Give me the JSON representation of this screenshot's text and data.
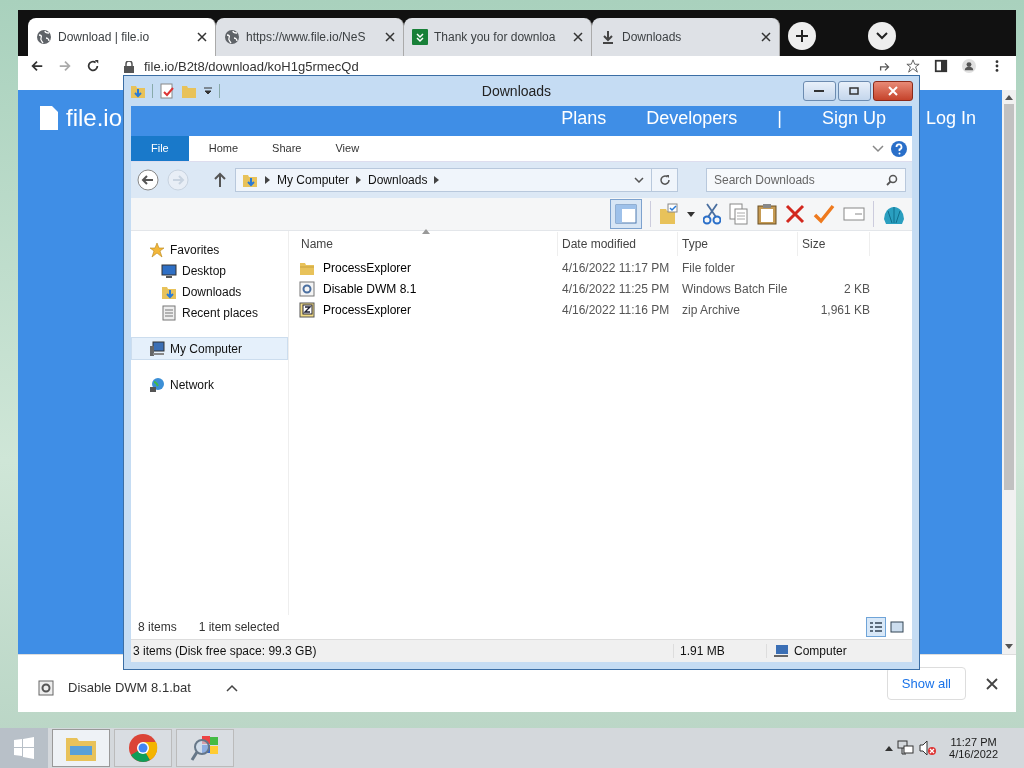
{
  "browser": {
    "tabs": [
      {
        "title": "Download | file.io",
        "kind": "globe",
        "selected": true
      },
      {
        "title": "https://www.file.io/NeS",
        "kind": "globe",
        "selected": false
      },
      {
        "title": "Thank you for downloa",
        "kind": "sheet",
        "selected": false
      },
      {
        "title": "Downloads",
        "kind": "download",
        "selected": false
      }
    ],
    "address": "file.io/B2t8/download/koH1g5rmecQd"
  },
  "site": {
    "logo": "file.io",
    "nav": [
      "Plans",
      "Developers",
      "|",
      "Sign Up",
      "Log In"
    ]
  },
  "explorer": {
    "title": "Downloads",
    "ribbon_tabs": [
      {
        "label": "File",
        "selected": true
      },
      {
        "label": "Home",
        "selected": false
      },
      {
        "label": "Share",
        "selected": false
      },
      {
        "label": "View",
        "selected": false
      }
    ],
    "breadcrumb": [
      "My Computer",
      "Downloads"
    ],
    "search": {
      "placeholder": "Search Downloads"
    },
    "nav_pane": [
      {
        "label": "Favorites",
        "kind": "star",
        "selected": false,
        "children": [
          {
            "label": "Desktop",
            "kind": "desktop",
            "selected": false
          },
          {
            "label": "Downloads",
            "kind": "downloads",
            "selected": false
          },
          {
            "label": "Recent places",
            "kind": "recent",
            "selected": false
          }
        ]
      },
      {
        "label": "My Computer",
        "kind": "computer",
        "selected": true
      },
      {
        "label": "Network",
        "kind": "network",
        "selected": false
      }
    ],
    "columns": [
      "Name",
      "Date modified",
      "Type",
      "Size"
    ],
    "rows": [
      {
        "name": "ProcessExplorer",
        "kind": "folder",
        "date": "4/16/2022 11:17 PM",
        "type": "File folder"
      },
      {
        "name": "Disable DWM 8.1",
        "kind": "batch",
        "date": "4/16/2022 11:25 PM",
        "type": "Windows Batch File",
        "size": "2 KB"
      },
      {
        "name": "ProcessExplorer",
        "kind": "zip",
        "date": "4/16/2022 11:16 PM",
        "type": "zip Archive",
        "size": "1,961 KB"
      }
    ],
    "item_count": "8 items",
    "selection": "1 item selected",
    "status": [
      "3 items (Disk free space: 99.3 GB)",
      "1.91 MB",
      "Computer"
    ]
  },
  "download_shelf": {
    "file": "Disable DWM 8.1.bat",
    "show_all": "Show all"
  },
  "taskbar": {
    "apps": [
      {
        "kind": "explorer",
        "selected": true
      },
      {
        "kind": "chrome",
        "selected": false
      },
      {
        "kind": "magnifier",
        "selected": false
      }
    ],
    "time": "11:27 PM",
    "date": "4/16/2022"
  }
}
